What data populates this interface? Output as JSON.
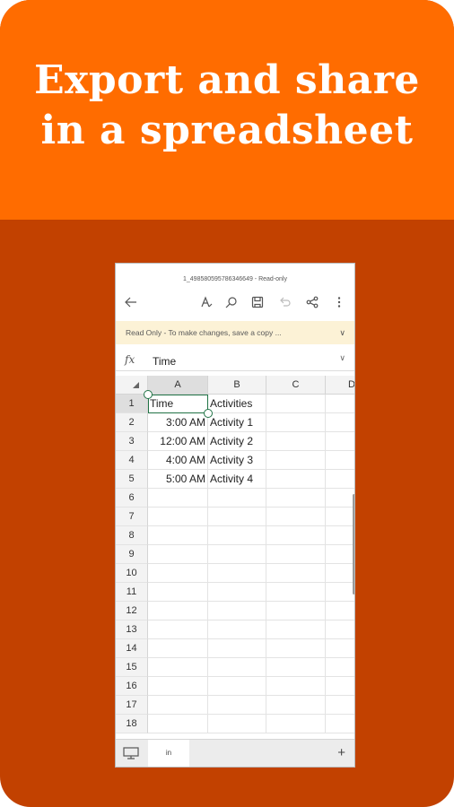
{
  "headline": {
    "line1": "Export and share",
    "line2": "in a spreadsheet"
  },
  "colors": {
    "banner": "#ff6c00",
    "background": "#c24100",
    "selection": "#217346"
  },
  "app": {
    "title": "1_498580595786346649 - Read-only",
    "toolbar_icons": [
      "back-arrow-icon",
      "draw-icon",
      "search-icon",
      "save-icon",
      "undo-icon",
      "share-icon",
      "more-icon"
    ],
    "notice": "Read Only - To make changes, save a copy ...",
    "formula_bar": {
      "icon": "fx",
      "value": "Time"
    },
    "columns": [
      "A",
      "B",
      "C",
      "D"
    ],
    "rows": [
      {
        "num": "1",
        "a": "Time",
        "b": "Activities"
      },
      {
        "num": "2",
        "a": "3:00 AM",
        "b": "Activity 1"
      },
      {
        "num": "3",
        "a": "12:00 AM",
        "b": "Activity 2"
      },
      {
        "num": "4",
        "a": "4:00 AM",
        "b": "Activity 3"
      },
      {
        "num": "5",
        "a": "5:00 AM",
        "b": "Activity 4"
      },
      {
        "num": "6",
        "a": "",
        "b": ""
      },
      {
        "num": "7",
        "a": "",
        "b": ""
      },
      {
        "num": "8",
        "a": "",
        "b": ""
      },
      {
        "num": "9",
        "a": "",
        "b": ""
      },
      {
        "num": "10",
        "a": "",
        "b": ""
      },
      {
        "num": "11",
        "a": "",
        "b": ""
      },
      {
        "num": "12",
        "a": "",
        "b": ""
      },
      {
        "num": "13",
        "a": "",
        "b": ""
      },
      {
        "num": "14",
        "a": "",
        "b": ""
      },
      {
        "num": "15",
        "a": "",
        "b": ""
      },
      {
        "num": "16",
        "a": "",
        "b": ""
      },
      {
        "num": "17",
        "a": "",
        "b": ""
      },
      {
        "num": "18",
        "a": "",
        "b": ""
      }
    ],
    "sheet_tab": "in",
    "add_sheet": "+"
  }
}
